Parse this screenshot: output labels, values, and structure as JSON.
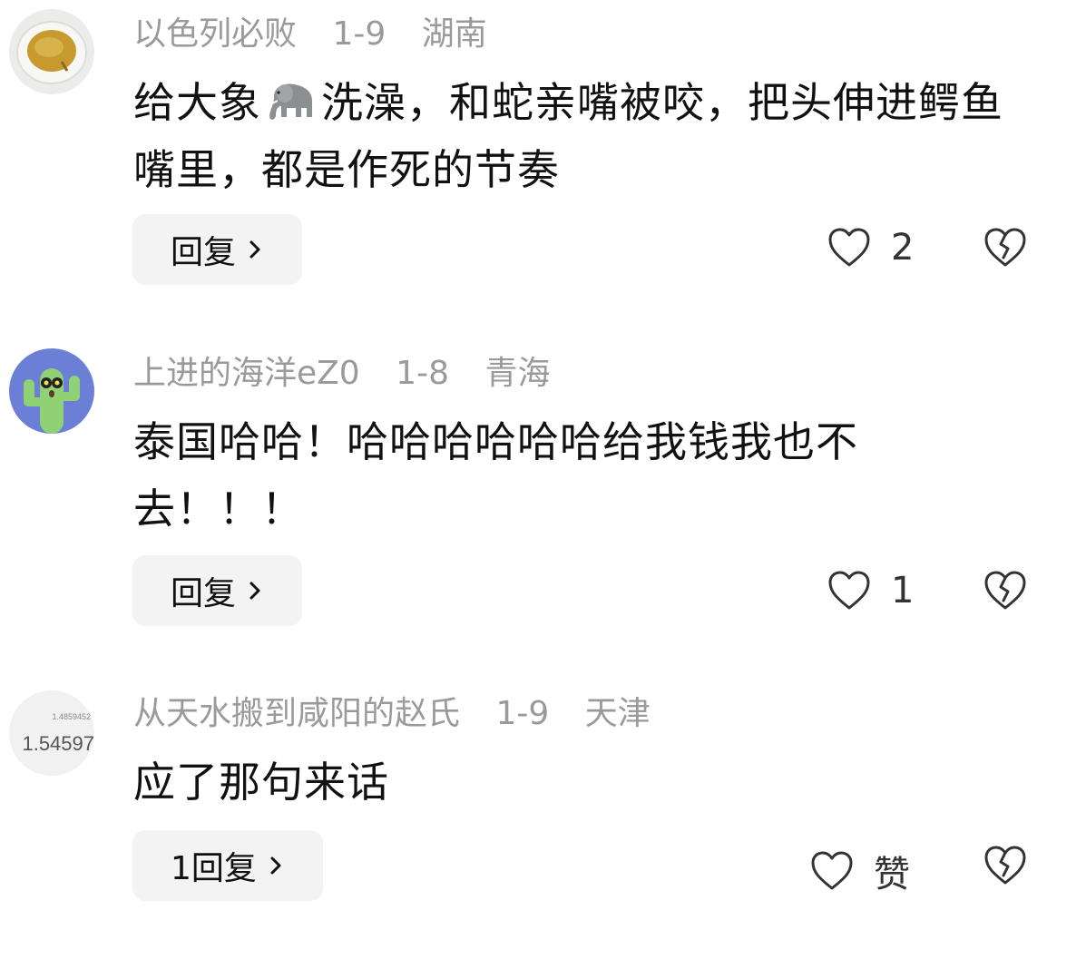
{
  "comments": [
    {
      "username": "以色列必败",
      "date": "1-9",
      "location": "湖南",
      "text_before_emoji": "给大象",
      "emoji": "elephant-emoji",
      "text_after_emoji": "洗澡，和蛇亲嘴被咬，把头伸进鳄鱼嘴里，都是作死的节奏",
      "reply_label": "回复",
      "like_count": "2",
      "avatar": "tea-cup-avatar"
    },
    {
      "username": "上进的海洋eZ0",
      "date": "1-8",
      "location": "青海",
      "text": "泰国哈哈！哈哈哈哈哈哈给我钱我也不去！！！",
      "reply_label": "回复",
      "like_count": "1",
      "avatar": "cactus-avatar"
    },
    {
      "username": "从天水搬到咸阳的赵氏",
      "date": "1-9",
      "location": "天津",
      "text": "应了那句来话",
      "reply_label": "1回复",
      "like_count": "赞",
      "avatar": "calculator-avatar",
      "avatar_text_small": "1.4859452",
      "avatar_text_large": "1.54597"
    }
  ],
  "colors": {
    "meta": "#9a9a9a",
    "reply_bg": "#f3f3f3",
    "icon": "#333333"
  }
}
